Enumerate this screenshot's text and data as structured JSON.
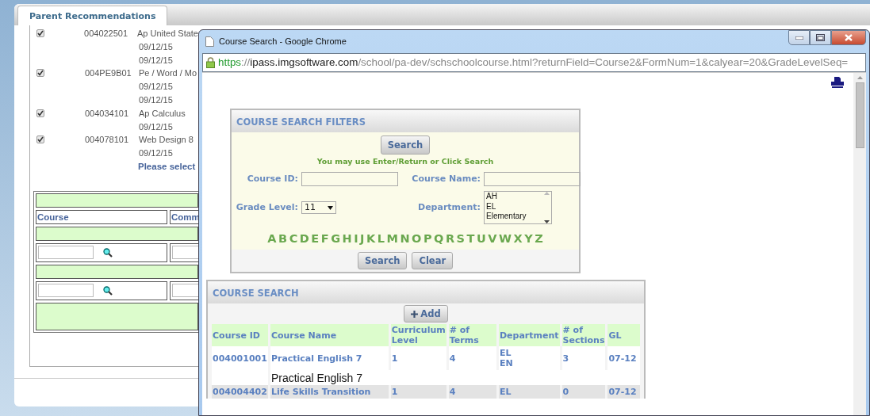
{
  "tab": {
    "label": "Parent Recommendations",
    "selected": true
  },
  "recommendations": [
    {
      "checked": true,
      "course_id": "004022501",
      "lines": [
        "Ap United State",
        "09/12/15",
        "09/12/15"
      ]
    },
    {
      "checked": true,
      "course_id": "004PE9B01",
      "lines": [
        "Pe / Word / Mo",
        "09/12/15",
        "09/12/15"
      ]
    },
    {
      "checked": true,
      "course_id": "004034101",
      "lines": [
        "Ap Calculus",
        "09/12/15"
      ]
    },
    {
      "checked": true,
      "course_id": "004078101",
      "lines": [
        "Web Design 8",
        "09/12/15"
      ]
    }
  ],
  "prompt": "Please select",
  "entry_table": {
    "columns": [
      "Course",
      "Comm"
    ],
    "rows": [
      {
        "kind": "band"
      },
      {
        "kind": "header"
      },
      {
        "kind": "band"
      },
      {
        "kind": "input"
      },
      {
        "kind": "band"
      },
      {
        "kind": "input"
      },
      {
        "kind": "tall-band"
      }
    ]
  },
  "popup": {
    "title": "Course Search - Google Chrome",
    "url": [
      {
        "kind": "scheme",
        "text": "https"
      },
      {
        "kind": "sep",
        "text": "://"
      },
      {
        "kind": "host",
        "text": "ipass.imgsoftware.com"
      },
      {
        "kind": "path",
        "text": "/school/pa-dev/schschoolcourse.html?returnField=Course2&FormNum=1&calyear=20&GradeLevelSeq="
      }
    ],
    "filters": {
      "title": "COURSE SEARCH FILTERS",
      "search_button": "Search",
      "hint": "You may use Enter/Return or Click Search",
      "course_id_label": "Course ID:",
      "course_name_label": "Course Name:",
      "grade_label": "Grade Level:",
      "grade_value": "11",
      "department_label": "Department:",
      "departments": [
        {
          "label": "AH",
          "selected": false
        },
        {
          "label": "EL",
          "selected": false
        },
        {
          "label": "Elementary",
          "selected": false
        }
      ],
      "letters": [
        "A",
        "B",
        "C",
        "D",
        "E",
        "F",
        "G",
        "H",
        "I",
        "J",
        "K",
        "L",
        "M",
        "N",
        "O",
        "P",
        "Q",
        "R",
        "S",
        "T",
        "U",
        "V",
        "W",
        "X",
        "Y",
        "Z"
      ],
      "buttons": [
        "Search",
        "Clear"
      ]
    },
    "results": {
      "title": "COURSE SEARCH",
      "add_button": "Add",
      "columns": [
        "Course ID",
        "Course Name",
        "Curriculum Level",
        "# of Terms",
        "Department",
        "# of Sections",
        "GL"
      ],
      "rows": [
        {
          "course_id": "004001001",
          "course_name": "Practical English 7",
          "curriculum_level": "1",
          "terms": "4",
          "departments": [
            "EL",
            "EN"
          ],
          "sections": "3",
          "gl": "07-12",
          "description": "Practical English 7"
        },
        {
          "course_id": "004004402",
          "course_name": "Life Skills Transition",
          "curriculum_level": "1",
          "terms": "4",
          "departments": [
            "EL"
          ],
          "sections": "0",
          "gl": "07-12"
        }
      ]
    }
  }
}
